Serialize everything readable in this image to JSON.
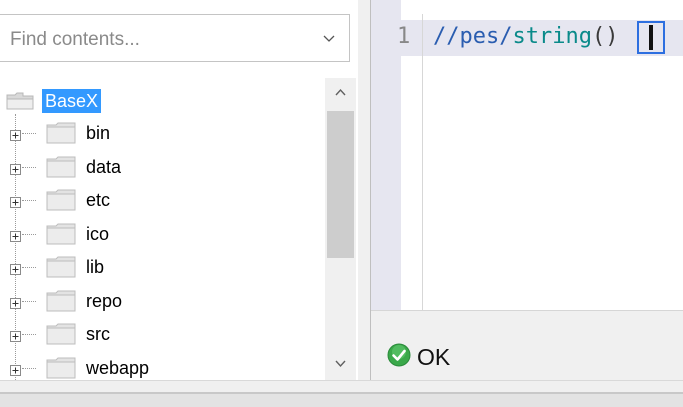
{
  "search": {
    "placeholder": "Find contents..."
  },
  "tree": {
    "root": {
      "label": "BaseX",
      "icon": "folder-open-icon"
    },
    "items": [
      {
        "label": "bin"
      },
      {
        "label": "data"
      },
      {
        "label": "etc"
      },
      {
        "label": "ico"
      },
      {
        "label": "lib"
      },
      {
        "label": "repo"
      },
      {
        "label": "src"
      },
      {
        "label": "webapp"
      }
    ]
  },
  "editor": {
    "line_number": "1",
    "code_prefix": "//pes/",
    "code_function": "string",
    "code_open": "(",
    "code_close": ")"
  },
  "status": {
    "text": "OK",
    "icon": "check-circle-icon",
    "color": "#3aa84a"
  },
  "colors": {
    "selection": "#3399ff",
    "code": "#2a5db0",
    "current_line": "#e6e6f0"
  }
}
